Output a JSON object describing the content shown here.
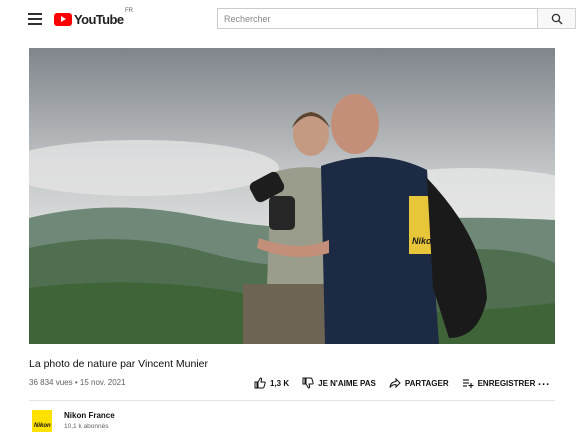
{
  "header": {
    "logo_text": "YouTube",
    "logo_region": "FR",
    "search_placeholder": "Rechercher"
  },
  "video": {
    "title": "La photo de nature par Vincent Munier",
    "views": "36 834 vues",
    "date": "15 nov. 2021",
    "separator": "•",
    "logo_overlay_text": "Nikon"
  },
  "actions": {
    "like_count": "1,3 K",
    "dislike_label": "JE N'AIME PAS",
    "share_label": "PARTAGER",
    "save_label": "ENREGISTRER",
    "more_label": "..."
  },
  "channel": {
    "name": "Nikon France",
    "subscribers": "10,1 k abonnés",
    "avatar_text": "Nikon"
  },
  "colors": {
    "brand_red": "#ff0000",
    "nikon_yellow": "#ffe100"
  }
}
